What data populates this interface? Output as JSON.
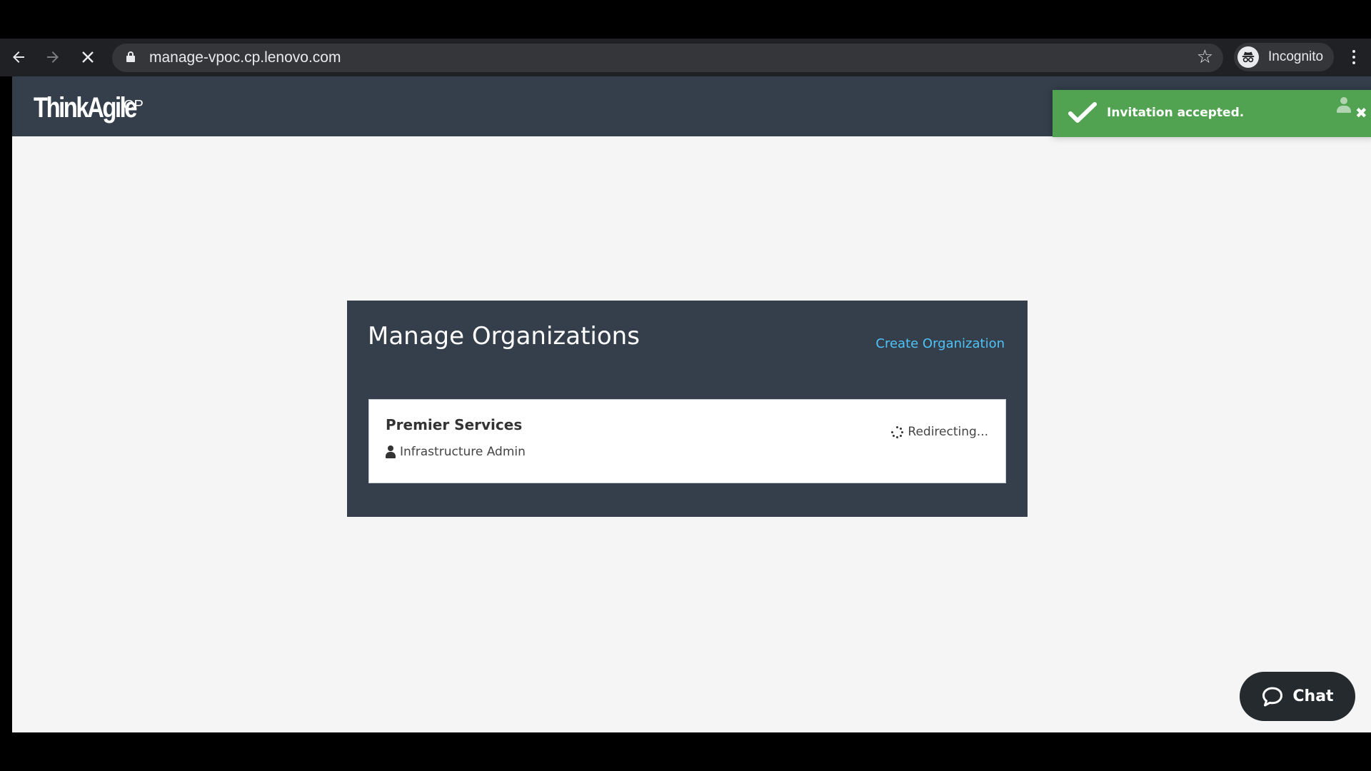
{
  "browser": {
    "url": "manage-vpoc.cp.lenovo.com",
    "profile_label": "Incognito",
    "icons": {
      "back": "back-arrow-icon",
      "forward": "forward-arrow-icon",
      "stop": "stop-loading-icon",
      "lock": "lock-icon",
      "bookmark": "star-icon",
      "incognito": "incognito-icon",
      "menu": "kebab-menu-icon"
    }
  },
  "app": {
    "brand": "ThinkAgile",
    "brand_sub": "CP",
    "colors": {
      "header_bg": "#343f4b",
      "page_bg": "#f5f5f5",
      "link": "#4fc3f7",
      "toast_success": "#51a351"
    }
  },
  "toast": {
    "message": "Invitation accepted.",
    "close_label": "✖"
  },
  "panel": {
    "title": "Manage Organizations",
    "create_link": "Create Organization",
    "organizations": [
      {
        "name": "Premier Services",
        "role": "Infrastructure Admin",
        "status": "Redirecting..."
      }
    ]
  },
  "chat": {
    "label": "Chat"
  }
}
